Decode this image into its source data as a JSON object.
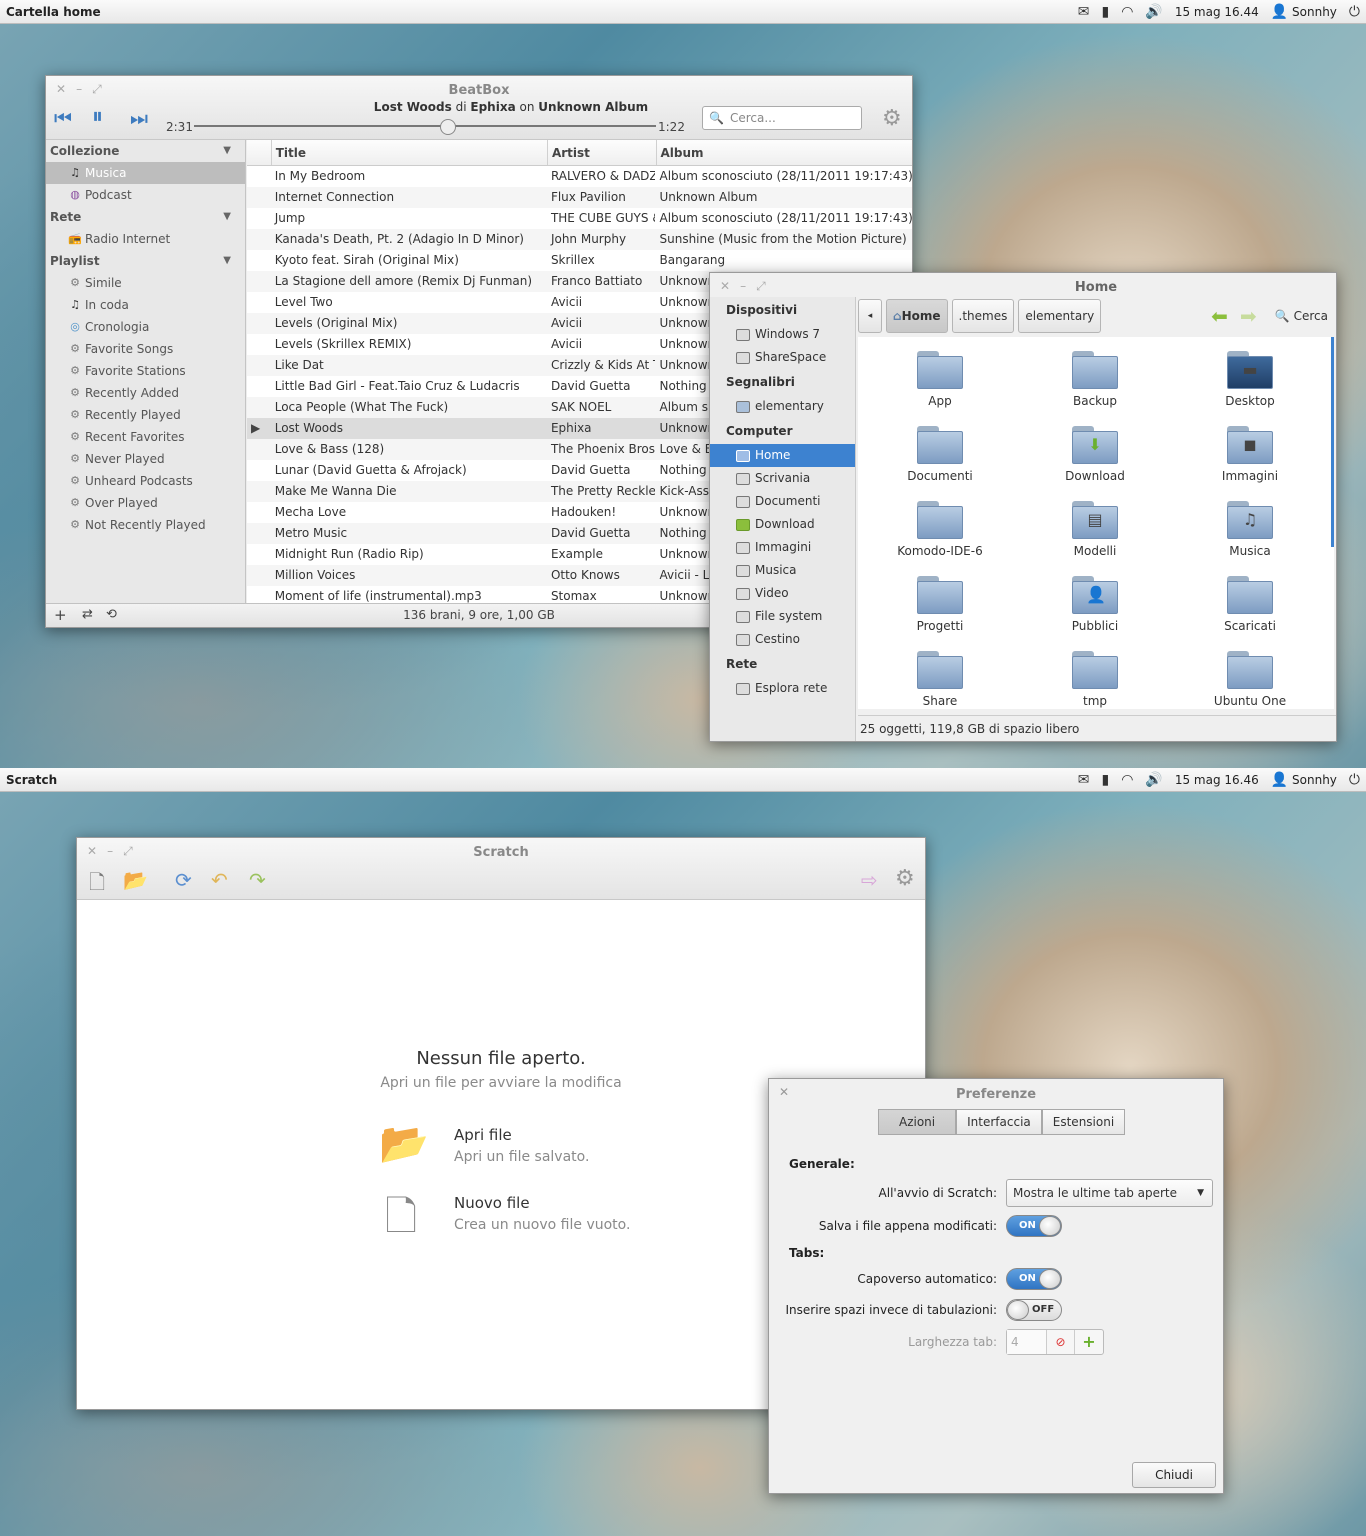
{
  "top_panel": {
    "title": "Cartella home",
    "time": "15 mag 16.44",
    "user": "Sonnhy"
  },
  "bottom_panel": {
    "title": "Scratch",
    "time": "15 mag 16.46",
    "user": "Sonnhy"
  },
  "beatbox": {
    "title": "BeatBox",
    "now_playing": {
      "song": "Lost Woods",
      "di": "di",
      "artist": "Ephixa",
      "on": "on",
      "album": "Unknown Album"
    },
    "elapsed": "2:31",
    "remaining": "1:22",
    "progress": 0.55,
    "search_placeholder": "Cerca...",
    "sidebar": {
      "collezione": "Collezione",
      "musica": "Musica",
      "podcast": "Podcast",
      "rete": "Rete",
      "radio": "Radio Internet",
      "playlist": "Playlist",
      "playlists": [
        "Simile",
        "In coda",
        "Cronologia",
        "Favorite Songs",
        "Favorite Stations",
        "Recently Added",
        "Recently Played",
        "Recent Favorites",
        "Never Played",
        "Unheard Podcasts",
        "Over Played",
        "Not Recently Played"
      ]
    },
    "columns": {
      "title": "Title",
      "artist": "Artist",
      "album": "Album"
    },
    "rows": [
      [
        "In My Bedroom",
        "RALVERO & DADZ",
        "Album sconosciuto (28/11/2011 19:17:43)"
      ],
      [
        "Internet Connection",
        "Flux Pavilion",
        "Unknown Album"
      ],
      [
        "Jump",
        "THE CUBE GUYS & L",
        "Album sconosciuto (28/11/2011 19:17:43)"
      ],
      [
        "Kanada's Death, Pt. 2 (Adagio In D Minor)",
        "John Murphy",
        "Sunshine (Music from the Motion Picture)"
      ],
      [
        "Kyoto feat. Sirah (Original Mix)",
        "Skrillex",
        "Bangarang"
      ],
      [
        "La Stagione dell amore (Remix Dj Funman)",
        "Franco Battiato",
        "Unknown"
      ],
      [
        "Level Two",
        "Avicii",
        "Unknown"
      ],
      [
        "Levels (Original Mix)",
        "Avicii",
        "Unknown"
      ],
      [
        "Levels (Skrillex REMIX)",
        "Avicii",
        "Unknown"
      ],
      [
        "Like Dat",
        "Crizzly & Kids At Th",
        "Unknown"
      ],
      [
        "Little Bad Girl - Feat.Taio Cruz & Ludacris",
        "David Guetta",
        "Nothing"
      ],
      [
        "Loca People (What The Fuck)",
        "SAK NOEL",
        "Album s"
      ],
      [
        "Lost Woods",
        "Ephixa",
        "Unknown"
      ],
      [
        "Love & Bass (128)",
        "The Phoenix Bros.",
        "Love & E"
      ],
      [
        "Lunar (David Guetta & Afrojack)",
        "David Guetta",
        "Nothing"
      ],
      [
        "Make Me Wanna Die",
        "The Pretty Reckles",
        "Kick-Ass"
      ],
      [
        "Mecha Love",
        "Hadouken!",
        "Unknown"
      ],
      [
        "Metro Music",
        "David Guetta",
        "Nothing"
      ],
      [
        "Midnight Run (Radio Rip)",
        "Example",
        "Unknown"
      ],
      [
        "Million Voices",
        "Otto Knows",
        "Avicii - L"
      ],
      [
        "Moment of life (instrumental).mp3",
        "Stomax",
        "Unknown"
      ]
    ],
    "playing_index": 12,
    "status": "136 brani, 9 ore, 1,00 GB"
  },
  "files": {
    "title": "Home",
    "sidebar": {
      "dispositivi": "Dispositivi",
      "dev": [
        "Windows 7",
        "ShareSpace"
      ],
      "segnalibri": "Segnalibri",
      "bm": [
        "elementary"
      ],
      "computer": "Computer",
      "comp": [
        "Home",
        "Scrivania",
        "Documenti",
        "Download",
        "Immagini",
        "Musica",
        "Video",
        "File system",
        "Cestino"
      ],
      "rete": "Rete",
      "net": [
        "Esplora rete"
      ]
    },
    "path": [
      "Home",
      ".themes",
      "elementary"
    ],
    "search_label": "Cerca",
    "items": [
      "App",
      "Backup",
      "Desktop",
      "Documenti",
      "Download",
      "Immagini",
      "Komodo-IDE-6",
      "Modelli",
      "Musica",
      "Progetti",
      "Pubblici",
      "Scaricati",
      "Share",
      "tmp",
      "Ubuntu One"
    ],
    "status": "25 oggetti, 119,8 GB di spazio libero"
  },
  "scratch": {
    "title": "Scratch",
    "heading": "Nessun file aperto.",
    "sub": "Apri un file per avviare la modifica",
    "open_title": "Apri file",
    "open_sub": "Apri un file salvato.",
    "new_title": "Nuovo file",
    "new_sub": "Crea un nuovo file vuoto."
  },
  "prefs": {
    "title": "Preferenze",
    "tabs": [
      "Azioni",
      "Interfaccia",
      "Estensioni"
    ],
    "generale": "Generale:",
    "avvio_label": "All'avvio di Scratch:",
    "avvio_value": "Mostra le ultime tab aperte",
    "salva_label": "Salva i file appena modificati:",
    "tabs_section": "Tabs:",
    "capoverso_label": "Capoverso automatico:",
    "spazi_label": "Inserire spazi invece di tabulazioni:",
    "larghezza_label": "Larghezza tab:",
    "larghezza_value": "4",
    "on": "ON",
    "off": "OFF",
    "close": "Chiudi"
  }
}
